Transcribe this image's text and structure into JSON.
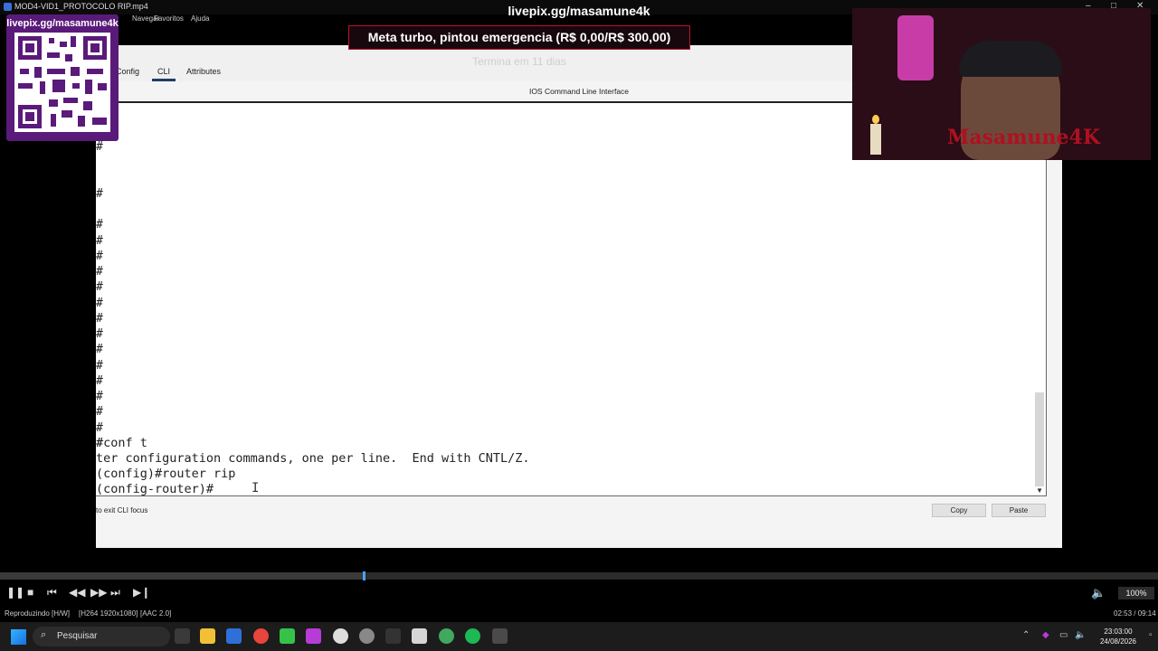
{
  "player": {
    "window_title": "MOD4-VID1_PROTOCOLO RIP.mp4",
    "menu": [
      "Navegar",
      "Favoritos",
      "Ajuda"
    ],
    "status_left": "Reproduzindo [H/W]",
    "status_codec_video": "[H264 1920x1080]",
    "status_codec_audio": "[AAC 2.0]",
    "time": "02:53 / 09:14",
    "volume": "100%",
    "progress_fraction": 0.313
  },
  "overlay": {
    "qr_url": "livepix.gg/masamune4k",
    "stream_url": "livepix.gg/masamune4k",
    "goal_text": "Meta turbo, pintou emergencia (R$ 0,00/R$ 300,00)",
    "goal_subtitle": "Termina em 11 dias",
    "cam_logo": "Masamune4K"
  },
  "packet_tracer": {
    "tabs": [
      "Config",
      "CLI",
      "Attributes"
    ],
    "active_tab": "CLI",
    "cli_title": "IOS Command Line Interface",
    "prompt_char": "#",
    "cli_lines": [
      "#conf t",
      "ter configuration commands, one per line.  End with CNTL/Z.",
      "(config)#router rip",
      "(config-router)#"
    ],
    "hint": "to exit CLI focus",
    "copy_label": "Copy",
    "paste_label": "Paste"
  },
  "taskbar": {
    "search_placeholder": "Pesquisar",
    "clock_time": "23:03:00",
    "clock_date": "24/08/2026"
  },
  "colors": {
    "goal_border": "#c0102a",
    "qr_panel": "#5a1a7a",
    "seek_knob": "#4aa3ff"
  }
}
